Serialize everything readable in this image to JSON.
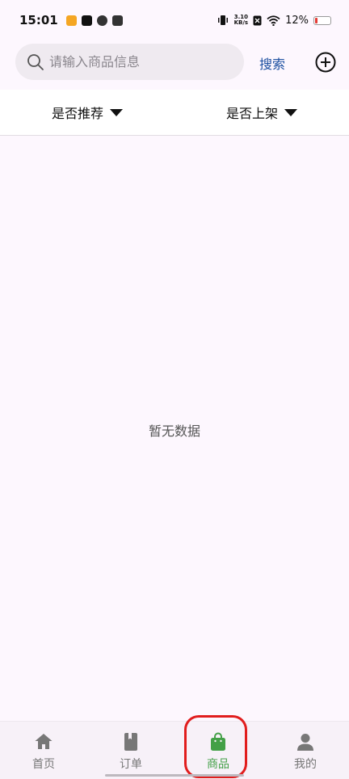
{
  "status_bar": {
    "time": "15:01",
    "net_speed_value": "3.10",
    "net_speed_unit": "KB/s",
    "battery": "12%"
  },
  "search": {
    "placeholder": "请输入商品信息",
    "button_label": "搜索"
  },
  "filters": [
    {
      "label": "是否推荐"
    },
    {
      "label": "是否上架"
    }
  ],
  "empty_state": "暂无数据",
  "bottom_nav": [
    {
      "label": "首页",
      "icon": "home-icon",
      "active": false
    },
    {
      "label": "订单",
      "icon": "book-icon",
      "active": false
    },
    {
      "label": "商品",
      "icon": "shopping-bag-icon",
      "active": true
    },
    {
      "label": "我的",
      "icon": "person-icon",
      "active": false
    }
  ],
  "colors": {
    "accent_active": "#43a047",
    "link_blue": "#1b4fa0",
    "highlight_red": "#e11d1d",
    "background": "#fdf7fe"
  }
}
